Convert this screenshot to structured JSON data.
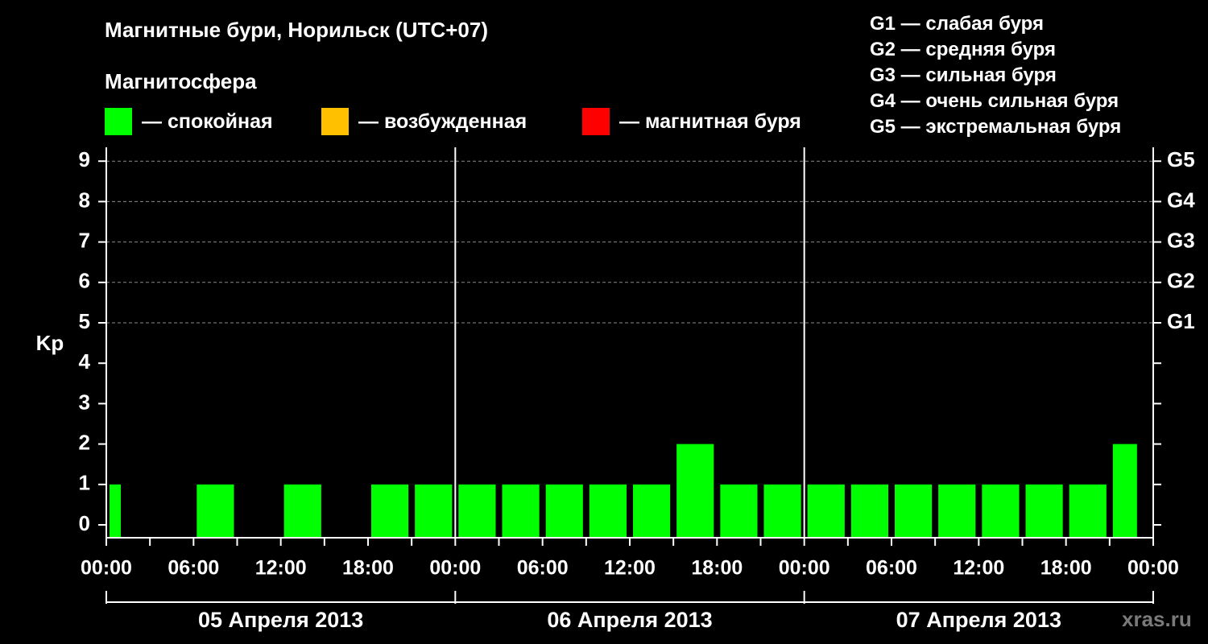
{
  "title": "Магнитные бури, Норильск (UTC+07)",
  "subtitle": "Магнитосфера",
  "legend": [
    {
      "label": "— спокойная",
      "color": "#00ff00"
    },
    {
      "label": "— возбужденная",
      "color": "#ffc000"
    },
    {
      "label": "— магнитная буря",
      "color": "#ff0000"
    }
  ],
  "g_scale": [
    "G1 — слабая буря",
    "G2 — средняя буря",
    "G3 — сильная буря",
    "G4 — очень сильная буря",
    "G5 — экстремальная буря"
  ],
  "watermark": "xras.ru",
  "chart_data": {
    "type": "bar",
    "ylabel": "Kp",
    "ylim": [
      0,
      9
    ],
    "y_ticks": [
      "0",
      "1",
      "2",
      "3",
      "4",
      "5",
      "6",
      "7",
      "8",
      "9"
    ],
    "right_ticks": [
      {
        "kp": 5,
        "label": "G1"
      },
      {
        "kp": 6,
        "label": "G2"
      },
      {
        "kp": 7,
        "label": "G3"
      },
      {
        "kp": 8,
        "label": "G4"
      },
      {
        "kp": 9,
        "label": "G5"
      }
    ],
    "x_tick_labels": [
      "00:00",
      "06:00",
      "12:00",
      "18:00",
      "00:00",
      "06:00",
      "12:00",
      "18:00",
      "00:00",
      "06:00",
      "12:00",
      "18:00",
      "00:00"
    ],
    "days": [
      "05 Апреля 2013",
      "06 Апреля 2013",
      "07 Апреля 2013"
    ],
    "interval_hours": 3,
    "bars": [
      {
        "start": "05 Апреля 2013 00:00",
        "kp": 1
      },
      {
        "start": "05 Апреля 2013 03:00",
        "kp": 0
      },
      {
        "start": "05 Апреля 2013 06:00",
        "kp": 1
      },
      {
        "start": "05 Апреля 2013 09:00",
        "kp": 0
      },
      {
        "start": "05 Апреля 2013 12:00",
        "kp": 1
      },
      {
        "start": "05 Апреля 2013 15:00",
        "kp": 0
      },
      {
        "start": "05 Апреля 2013 18:00",
        "kp": 1
      },
      {
        "start": "05 Апреля 2013 21:00",
        "kp": 1
      },
      {
        "start": "06 Апреля 2013 00:00",
        "kp": 1
      },
      {
        "start": "06 Апреля 2013 03:00",
        "kp": 1
      },
      {
        "start": "06 Апреля 2013 06:00",
        "kp": 1
      },
      {
        "start": "06 Апреля 2013 09:00",
        "kp": 1
      },
      {
        "start": "06 Апреля 2013 12:00",
        "kp": 1
      },
      {
        "start": "06 Апреля 2013 15:00",
        "kp": 2
      },
      {
        "start": "06 Апреля 2013 18:00",
        "kp": 1
      },
      {
        "start": "06 Апреля 2013 21:00",
        "kp": 1
      },
      {
        "start": "07 Апреля 2013 00:00",
        "kp": 1
      },
      {
        "start": "07 Апреля 2013 03:00",
        "kp": 1
      },
      {
        "start": "07 Апреля 2013 06:00",
        "kp": 1
      },
      {
        "start": "07 Апреля 2013 09:00",
        "kp": 1
      },
      {
        "start": "07 Апреля 2013 12:00",
        "kp": 1
      },
      {
        "start": "07 Апреля 2013 15:00",
        "kp": 1
      },
      {
        "start": "07 Апреля 2013 18:00",
        "kp": 1
      },
      {
        "start": "07 Апреля 2013 21:00",
        "kp": 2
      }
    ],
    "bar_color": "#00ff00"
  }
}
